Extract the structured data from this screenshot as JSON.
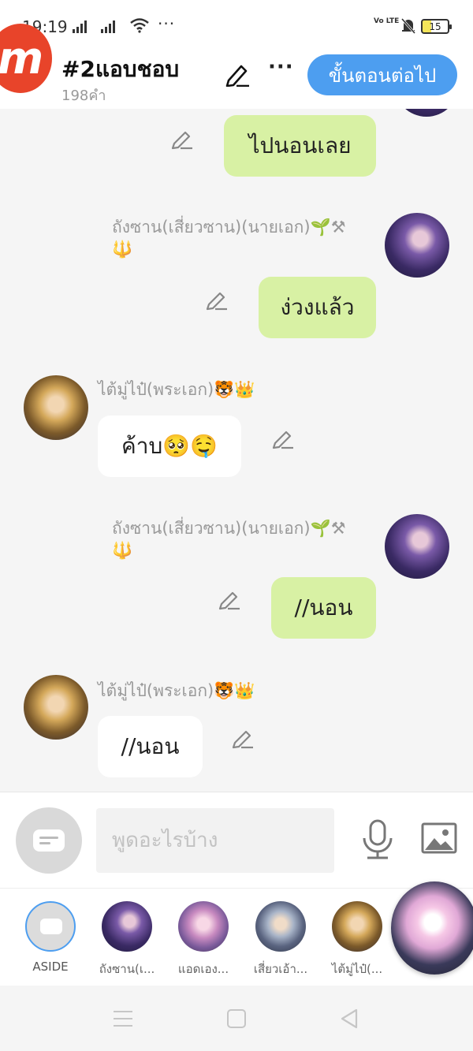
{
  "status_bar": {
    "time": "19:19",
    "dots": "···",
    "network": "Vo LTE",
    "battery": "15"
  },
  "header": {
    "title": "#2แอบชอบ",
    "word_count": "198คำ",
    "more": "···",
    "next_label": "ขั้นตอนต่อไป",
    "logo_letter": "m"
  },
  "messages": [
    {
      "side": "right",
      "text": "ไปนอนเลย"
    },
    {
      "side": "right",
      "speaker": "ถังซาน(เสี่ยวซาน)(นายเอก)🌱⚒",
      "speaker_line2": "🔱",
      "text": "ง่วงแล้ว"
    },
    {
      "side": "left",
      "speaker": "ไต้มู่ไป๋(พระเอก)🐯👑",
      "text": "ค้าบ🥺🤤"
    },
    {
      "side": "right",
      "speaker": "ถังซาน(เสี่ยวซาน)(นายเอก)🌱⚒",
      "speaker_line2": "🔱",
      "text": "//นอน"
    },
    {
      "side": "left",
      "speaker": "ไต้มู่ไป๋(พระเอก)🐯👑",
      "text": "//นอน"
    }
  ],
  "input": {
    "placeholder": "พูดอะไรบ้าง"
  },
  "characters": [
    {
      "name": "ASIDE",
      "selected": true
    },
    {
      "name": "ถังซาน(เ..."
    },
    {
      "name": "แอดเอง..."
    },
    {
      "name": "เสี่ยวเอ้า..."
    },
    {
      "name": "ไต้มู่ไป๋(..."
    }
  ],
  "colors": {
    "accent": "#4d9ef0",
    "bubble_right": "#d8f1a4",
    "bubble_left": "#ffffff",
    "logo": "#e8442a"
  }
}
